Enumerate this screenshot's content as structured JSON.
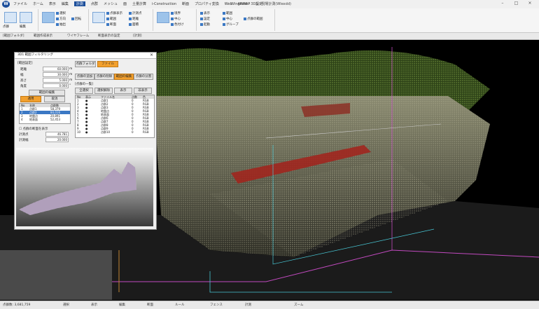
{
  "window": {
    "title": "Wingfield - 3D1 : 現場計測(Wlexdd)",
    "logo": "W"
  },
  "menu": [
    "ファイル",
    "ホーム",
    "表示",
    "編集",
    "計測",
    "点群",
    "メッシュ",
    "面",
    "土量計算",
    "i-Construction",
    "断面",
    "プロパティ変換",
    "Web",
    "ARMAP",
    "設定"
  ],
  "menu_active_index": 4,
  "ribbon": {
    "group1": [
      "点群",
      "編集",
      "削除",
      "確認"
    ],
    "group2": [
      "選択",
      "方向",
      "抽出",
      "回転"
    ],
    "group3": [
      "点群表示",
      "範囲",
      "断面",
      "計測点",
      "距離",
      "面積"
    ],
    "group4": [
      "境界",
      "中心",
      "色付け",
      "表示"
    ],
    "group5": [
      "表示",
      "設定",
      "起動",
      "範囲",
      "中心",
      "グループ",
      "点群の範囲"
    ]
  },
  "subbar": [
    "[範囲フォルダ]",
    "範囲作成表示",
    "ワイヤフレーム",
    "断面表示の設定",
    "[計測]"
  ],
  "dialog": {
    "title": "3D1 範囲フィルタリング",
    "section_label": "[範囲設定]",
    "fields": [
      {
        "label": "距離",
        "value": "60.000",
        "unit": "m"
      },
      {
        "label": "幅",
        "value": "30.000",
        "unit": "m"
      },
      {
        "label": "高さ",
        "value": "5.000",
        "unit": "m"
      },
      {
        "label": "角度",
        "value": "0.000",
        "unit": "°"
      }
    ],
    "range_button": "範囲の編集",
    "apply_button": "適用",
    "cancel_button": "取消",
    "list_headers": [
      "No",
      "名称",
      "点群数"
    ],
    "list_rows": [
      {
        "no": "1",
        "name": "点群1",
        "count": "58,379"
      },
      {
        "no": "2",
        "name": "点群2",
        "count": "84,016"
      },
      {
        "no": "3",
        "name": "地盤点",
        "count": "20,891"
      },
      {
        "no": "4",
        "name": "地表面",
        "count": "52,453"
      }
    ],
    "check1": "点群の断面を表示",
    "check2": "断面を保存",
    "measure1_label": "計測点",
    "measure1_value": "46.781",
    "measure2_label": "計測幅",
    "measure2_value": "20.000",
    "right_tabs": [
      "点群フォルダ",
      "ファイル"
    ],
    "right_buttons": [
      "点群の追加",
      "点群の削除",
      "範囲の編集",
      "点群の分割"
    ],
    "sub_section": "[点群の一覧]",
    "sub_buttons": [
      "全選択",
      "選択解除",
      "表示",
      "非表示"
    ],
    "table_headers": [
      "No",
      "表示",
      "ファイル名",
      "点数",
      "色"
    ],
    "table_rows": [
      {
        "no": "1",
        "vis": "●",
        "name": "点群1",
        "cnt": "0",
        "color": "RGB"
      },
      {
        "no": "2",
        "vis": "●",
        "name": "点群2",
        "cnt": "0",
        "color": "RGB"
      },
      {
        "no": "3",
        "vis": "●",
        "name": "点群3",
        "cnt": "0",
        "color": "RGB"
      },
      {
        "no": "4",
        "vis": "●",
        "name": "地盤点",
        "cnt": "0",
        "color": "RGB"
      },
      {
        "no": "5",
        "vis": "●",
        "name": "地表面",
        "cnt": "0",
        "color": "RGB"
      },
      {
        "no": "6",
        "vis": "●",
        "name": "点群6",
        "cnt": "0",
        "color": "RGB"
      },
      {
        "no": "7",
        "vis": "●",
        "name": "点群7",
        "cnt": "0",
        "color": "RGB"
      },
      {
        "no": "8",
        "vis": "●",
        "name": "点群8",
        "cnt": "0",
        "color": "RGB"
      },
      {
        "no": "9",
        "vis": "●",
        "name": "点群9",
        "cnt": "0",
        "color": "RGB"
      },
      {
        "no": "10",
        "vis": "●",
        "name": "点群10",
        "cnt": "0",
        "color": "RGB"
      }
    ]
  },
  "status": {
    "left": "点群数: 3,681,759",
    "items": [
      "選択",
      "表示",
      "編集",
      "断面",
      "ルール",
      "フェンス",
      "計測"
    ],
    "scale_label": "ズーム"
  },
  "colors": {
    "accent": "#f2a02e",
    "brand": "#1d4f9b",
    "selection": "#3b78c4"
  }
}
